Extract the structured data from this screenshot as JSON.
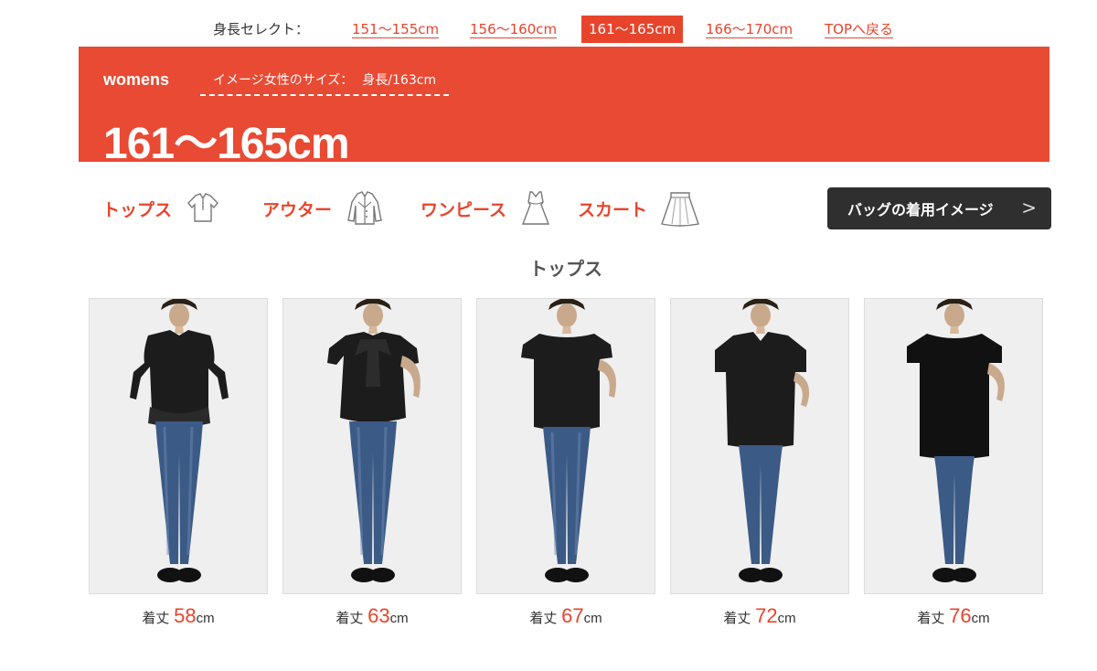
{
  "nav": {
    "label": "身長セレクト：",
    "links": [
      {
        "label": "151〜155cm"
      },
      {
        "label": "156〜160cm"
      },
      {
        "label": "161〜165cm",
        "active": true
      },
      {
        "label": "166〜170cm"
      },
      {
        "label": "TOPへ戻る"
      }
    ]
  },
  "banner": {
    "brand": "womens",
    "size_label": "イメージ女性のサイズ：",
    "size_value": "身長/163cm",
    "title": "161〜165cm",
    "color": "#e84a33"
  },
  "categories": [
    {
      "label": "トップス",
      "icon": "blouse-icon"
    },
    {
      "label": "アウター",
      "icon": "jacket-icon"
    },
    {
      "label": "ワンピース",
      "icon": "dress-icon"
    },
    {
      "label": "スカート",
      "icon": "skirt-icon"
    }
  ],
  "bag_button": {
    "label": "バッグの着用イメージ",
    "chevron": ">"
  },
  "section_title": "トップス",
  "products": [
    {
      "length_label": "着丈",
      "length": "58",
      "unit": "cm"
    },
    {
      "length_label": "着丈",
      "length": "63",
      "unit": "cm"
    },
    {
      "length_label": "着丈",
      "length": "67",
      "unit": "cm"
    },
    {
      "length_label": "着丈",
      "length": "72",
      "unit": "cm"
    },
    {
      "length_label": "着丈",
      "length": "76",
      "unit": "cm"
    }
  ],
  "colors": {
    "accent": "#e8442c",
    "dark_button": "#2f2f2f",
    "photo_bg": "#efefef"
  }
}
